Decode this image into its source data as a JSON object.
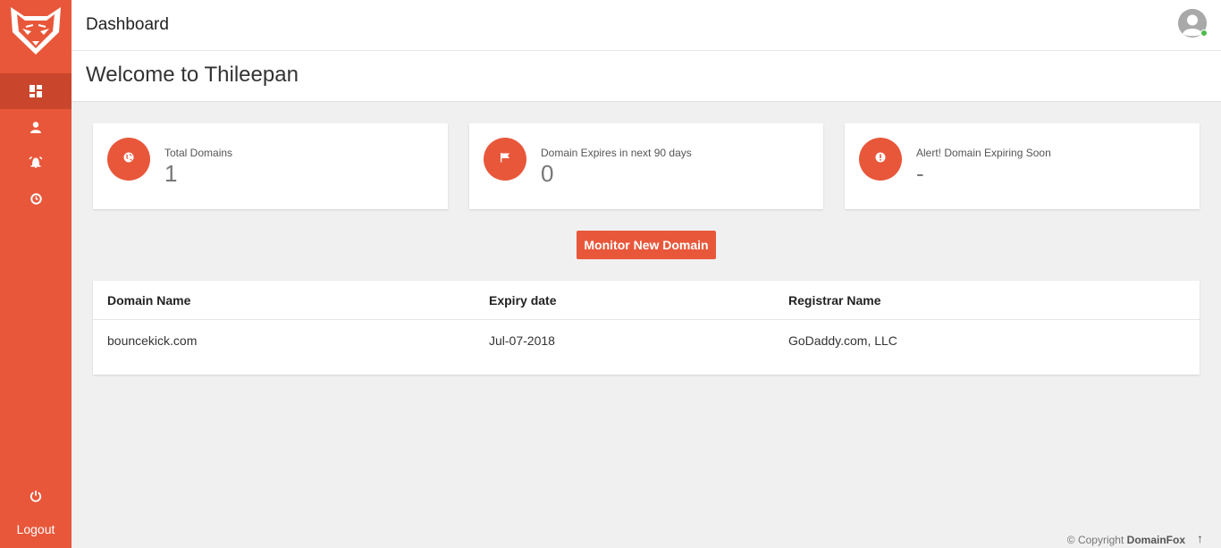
{
  "sidebar": {
    "logo_icon": "fox-logo-icon",
    "items": [
      {
        "icon": "dashboard-icon"
      },
      {
        "icon": "user-icon"
      },
      {
        "icon": "alarm-icon"
      },
      {
        "icon": "clock-icon"
      }
    ],
    "power_icon": "power-icon",
    "logout_label": "Logout"
  },
  "header": {
    "title": "Dashboard",
    "avatar_icon": "avatar-icon",
    "status": "online"
  },
  "welcome": {
    "text": "Welcome to Thileepan"
  },
  "stats": [
    {
      "icon": "globe-icon",
      "label": "Total Domains",
      "value": "1"
    },
    {
      "icon": "flag-icon",
      "label": "Domain Expires in next 90 days",
      "value": "0"
    },
    {
      "icon": "alert-icon",
      "label": "Alert! Domain Expiring Soon",
      "value": "-"
    }
  ],
  "monitor_button": {
    "label": "Monitor New Domain"
  },
  "table": {
    "columns": [
      "Domain Name",
      "Expiry date",
      "Registrar Name"
    ],
    "rows": [
      [
        "bouncekick.com",
        "Jul-07-2018",
        "GoDaddy.com, LLC"
      ]
    ]
  },
  "footer": {
    "prefix": "© Copyright",
    "brand": "DomainFox",
    "arrow": "↑"
  },
  "colors": {
    "accent": "#e8573a",
    "accent_dark": "#c9452c",
    "background": "#f0f0f0",
    "online": "#4cbb4a"
  }
}
